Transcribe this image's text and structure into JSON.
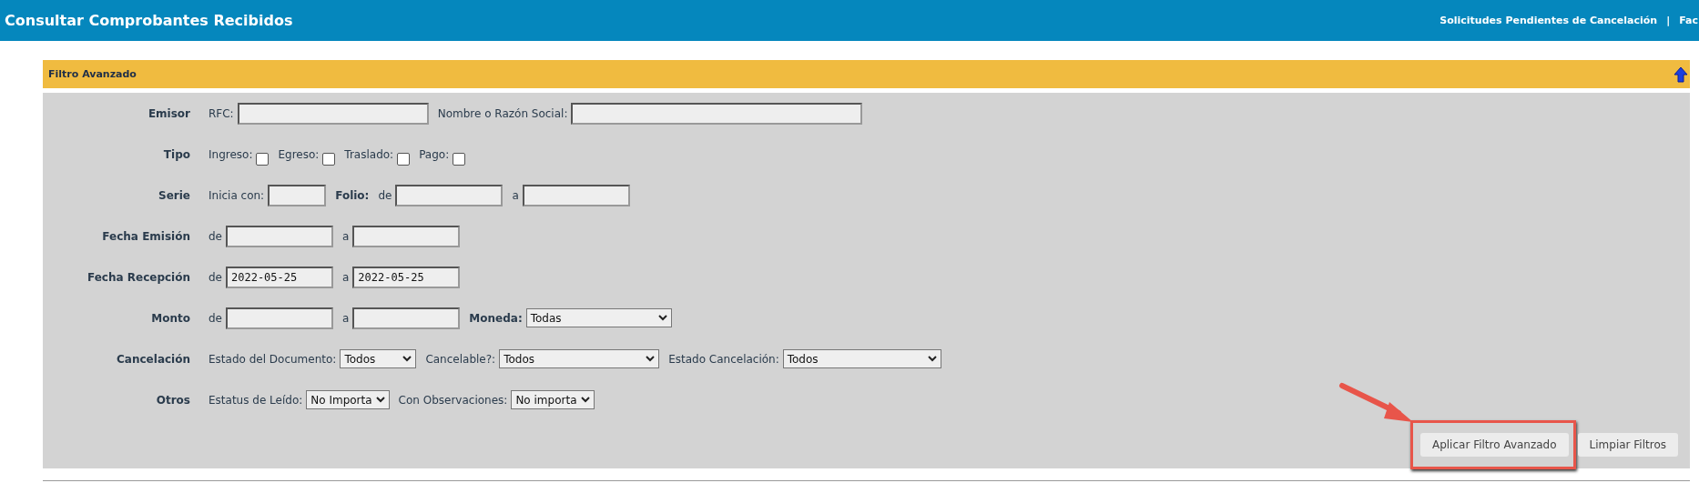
{
  "header": {
    "title": "Consultar Comprobantes Recibidos",
    "links": [
      "Solicitudes Pendientes de Cancelación",
      "Fac"
    ],
    "separator": "|"
  },
  "panel": {
    "title": "Filtro Avanzado",
    "expanded": true
  },
  "rows": [
    {
      "label": "Emisor",
      "items": [
        {
          "kind": "text",
          "text": "RFC:"
        },
        {
          "kind": "input"
        },
        {
          "kind": "text",
          "text": "Nombre o Razón Social:"
        },
        {
          "kind": "input"
        }
      ]
    },
    {
      "label": "Tipo",
      "items": [
        {
          "kind": "text",
          "text": "Ingreso:"
        },
        {
          "kind": "checkbox",
          "checked": false
        },
        {
          "kind": "text",
          "text": "Egreso:"
        },
        {
          "kind": "checkbox",
          "checked": false
        },
        {
          "kind": "text",
          "text": "Traslado:"
        },
        {
          "kind": "checkbox",
          "checked": false
        },
        {
          "kind": "text",
          "text": "Pago:"
        },
        {
          "kind": "checkbox",
          "checked": false
        }
      ]
    },
    {
      "label": "Serie",
      "items": [
        {
          "kind": "text",
          "text": "Inicia con:"
        },
        {
          "kind": "input"
        },
        {
          "kind": "label",
          "text": "Folio:"
        },
        {
          "kind": "text",
          "text": "de"
        },
        {
          "kind": "input"
        },
        {
          "kind": "text",
          "text": "a"
        },
        {
          "kind": "input"
        }
      ]
    },
    {
      "label": "Fecha Emisión",
      "items": [
        {
          "kind": "text",
          "text": "de"
        },
        {
          "kind": "input"
        },
        {
          "kind": "text",
          "text": "a"
        },
        {
          "kind": "input"
        }
      ]
    },
    {
      "label": "Fecha Recepción",
      "items": [
        {
          "kind": "text",
          "text": "de"
        },
        {
          "kind": "input",
          "value": "2022-05-25"
        },
        {
          "kind": "text",
          "text": "a"
        },
        {
          "kind": "input",
          "value": "2022-05-25"
        }
      ]
    },
    {
      "label": "Monto",
      "items": [
        {
          "kind": "text",
          "text": "de"
        },
        {
          "kind": "input"
        },
        {
          "kind": "text",
          "text": "a"
        },
        {
          "kind": "input"
        },
        {
          "kind": "label",
          "text": "Moneda:"
        },
        {
          "kind": "select",
          "value": "Todas"
        }
      ]
    },
    {
      "label": "Cancelación",
      "items": [
        {
          "kind": "text",
          "text": "Estado del Documento:"
        },
        {
          "kind": "select",
          "value": "Todos"
        },
        {
          "kind": "text",
          "text": "Cancelable?:"
        },
        {
          "kind": "select",
          "value": "Todos"
        },
        {
          "kind": "text",
          "text": "Estado Cancelación:"
        },
        {
          "kind": "select",
          "value": "Todos"
        }
      ]
    },
    {
      "label": "Otros",
      "items": [
        {
          "kind": "text",
          "text": "Estatus de Leído:"
        },
        {
          "kind": "select",
          "value": "No Importa"
        },
        {
          "kind": "text",
          "text": "Con Observaciones:"
        },
        {
          "kind": "select",
          "value": "No importa"
        }
      ]
    }
  ],
  "buttons": [
    {
      "label": "Aplicar Filtro Avanzado",
      "highlighted": true
    },
    {
      "label": "Limpiar Filtros",
      "highlighted": false
    }
  ]
}
